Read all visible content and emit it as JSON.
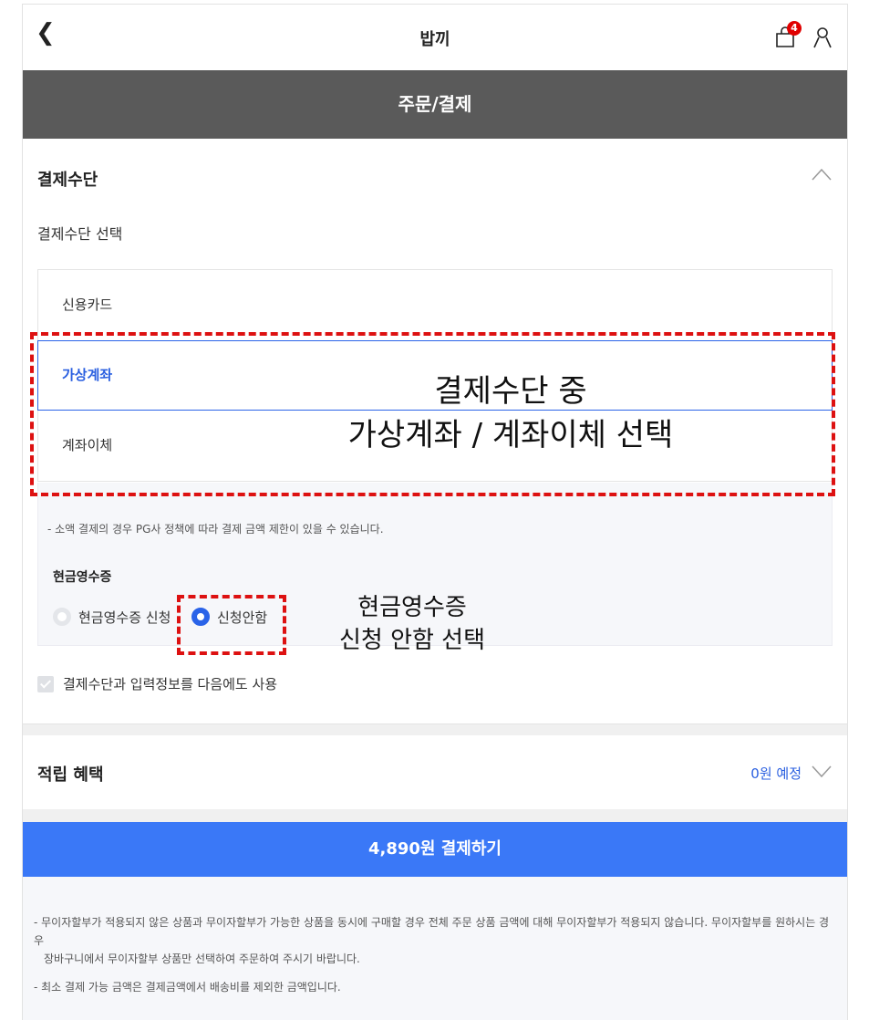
{
  "header": {
    "back_icon": "chevron-left-icon",
    "brand": "밥끼",
    "cart_badge": "4",
    "cart_icon": "shopping-bag-icon",
    "user_icon": "user-icon"
  },
  "page_title": "주문/결제",
  "payment": {
    "section_title": "결제수단",
    "collapse_icon": "chevron-up-icon",
    "subtitle": "결제수단 선택",
    "methods": [
      {
        "label": "신용카드",
        "selected": false
      },
      {
        "label": "가상계좌",
        "selected": true
      },
      {
        "label": "계좌이체",
        "selected": false
      }
    ],
    "notice": "- 소액 결제의 경우 PG사 정책에 따라 결제 금액 제한이 있을 수 있습니다.",
    "cash_receipt": {
      "title": "현금영수증",
      "options": [
        {
          "label": "현금영수증 신청",
          "selected": false
        },
        {
          "label": "신청안함",
          "selected": true
        }
      ]
    },
    "remember_label": "결제수단과 입력정보를 다음에도 사용",
    "remember_checked": true
  },
  "reward": {
    "title": "적립 혜택",
    "value": "0원 예정",
    "expand_icon": "chevron-down-icon"
  },
  "pay_button": "4,890원 결제하기",
  "footer_notes": {
    "note1_line1": "- 무이자할부가 적용되지 않은 상품과 무이자할부가 가능한 상품을 동시에 구매할 경우 전체 주문 상품 금액에 대해 무이자할부가 적용되지 않습니다. 무이자할부를 원하시는 경우",
    "note1_line2": "장바구니에서 무이자할부 상품만 선택하여 주문하여 주시기 바랍니다.",
    "note2": "- 최소 결제 가능 금액은 결제금액에서 배송비를 제외한 금액입니다."
  },
  "annotations": {
    "methods_line1": "결제수단 중",
    "methods_line2": "가상계좌 / 계좌이체 선택",
    "receipt_line1": "현금영수증",
    "receipt_line2": "신청 안함 선택",
    "color": "#dd1111"
  },
  "colors": {
    "accent": "#3a78f7",
    "title_bar": "#5a5a5a",
    "selected_text": "#2a5fe0",
    "badge": "#e00000"
  }
}
